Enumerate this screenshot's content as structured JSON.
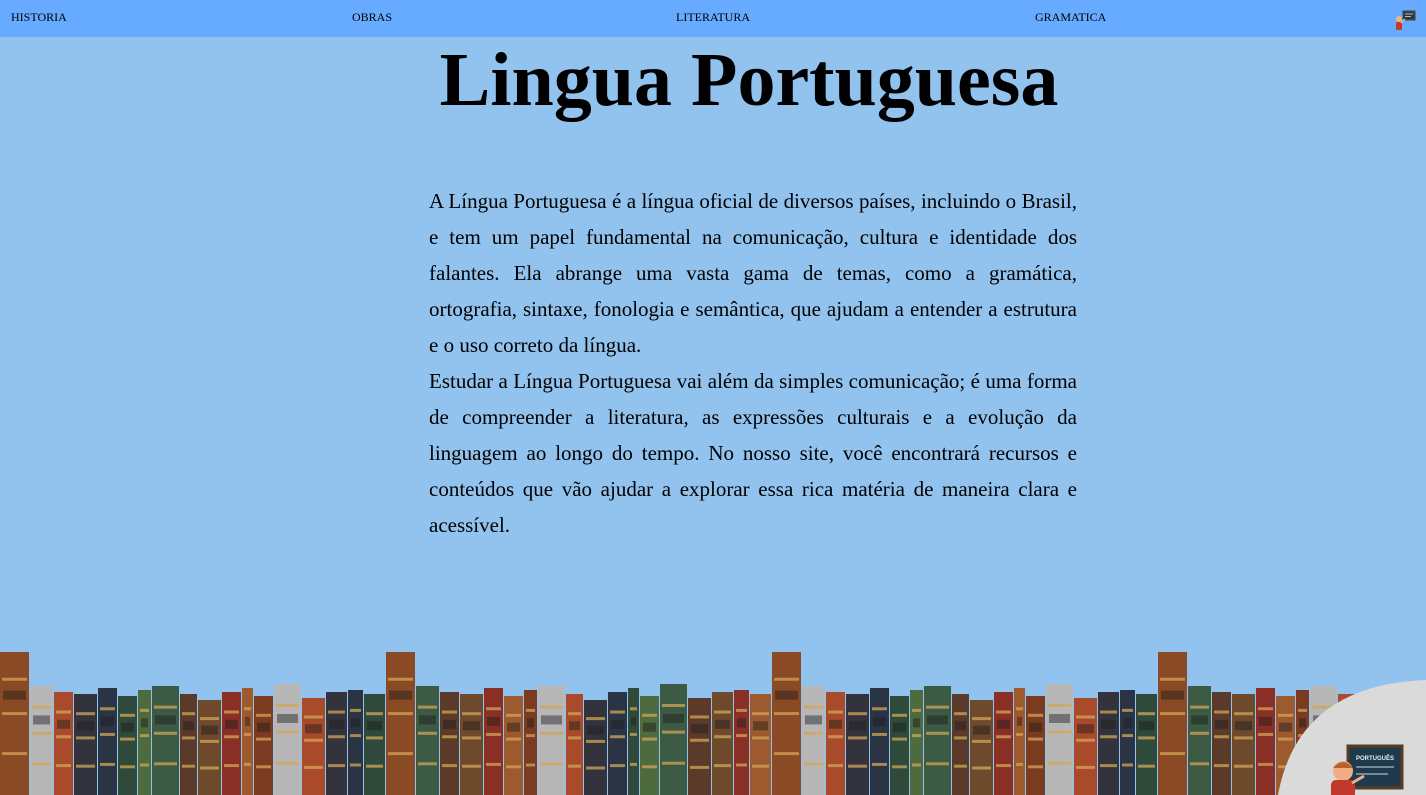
{
  "nav": {
    "items": [
      {
        "label": "HISTORIA"
      },
      {
        "label": "OBRAS"
      },
      {
        "label": "LITERATURA"
      },
      {
        "label": "GRAMATICA"
      }
    ],
    "icon": "teacher-chalkboard-icon"
  },
  "main": {
    "title": "Lingua Portuguesa",
    "paragraphs": [
      "A Língua Portuguesa é a língua oficial de diversos países, incluindo o Brasil, e tem um papel fundamental na comunicação, cultura e identidade dos falantes. Ela abrange uma vasta gama de temas, como a gramática, ortografia, sintaxe, fonologia e semântica, que ajudam a entender a estrutura e o uso correto da língua.",
      "Estudar a Língua Portuguesa vai além da simples comunicação; é uma forma de compreender a literatura, as expressões culturais e a evolução da linguagem ao longo do tempo. No nosso site, você encontrará recursos e conteúdos que vão ajudar a explorar essa rica matéria de maneira clara e acessível."
    ]
  },
  "decor": {
    "shelf": "bookshelf-illustration",
    "mascot": "teacher-mascot-icon",
    "mascot_board_text": "PORTUGUÊS"
  },
  "colors": {
    "background": "#92c3ee",
    "navbar": "#66abff"
  }
}
